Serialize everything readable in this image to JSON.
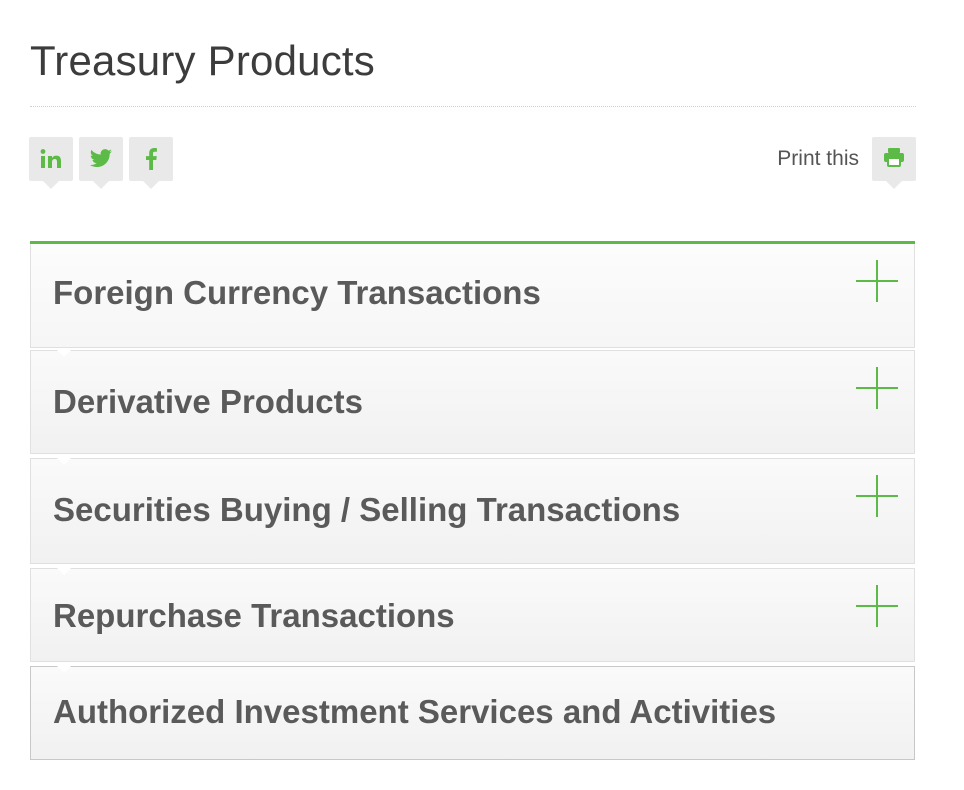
{
  "page": {
    "title": "Treasury Products"
  },
  "share": {
    "buttons": [
      {
        "icon": "linkedin-icon"
      },
      {
        "icon": "twitter-icon"
      },
      {
        "icon": "facebook-icon"
      }
    ],
    "icon_color": "#5cba47"
  },
  "print": {
    "label": "Print this",
    "icon": "printer-icon"
  },
  "accordion": {
    "accent_color": "#5cba47",
    "items": [
      {
        "label": "Foreign Currency Transactions",
        "expandable": true
      },
      {
        "label": "Derivative Products",
        "expandable": true
      },
      {
        "label": "Securities Buying / Selling Transactions",
        "expandable": true
      },
      {
        "label": "Repurchase Transactions",
        "expandable": true
      },
      {
        "label": "Authorized Investment Services and Activities",
        "expandable": false
      }
    ]
  }
}
